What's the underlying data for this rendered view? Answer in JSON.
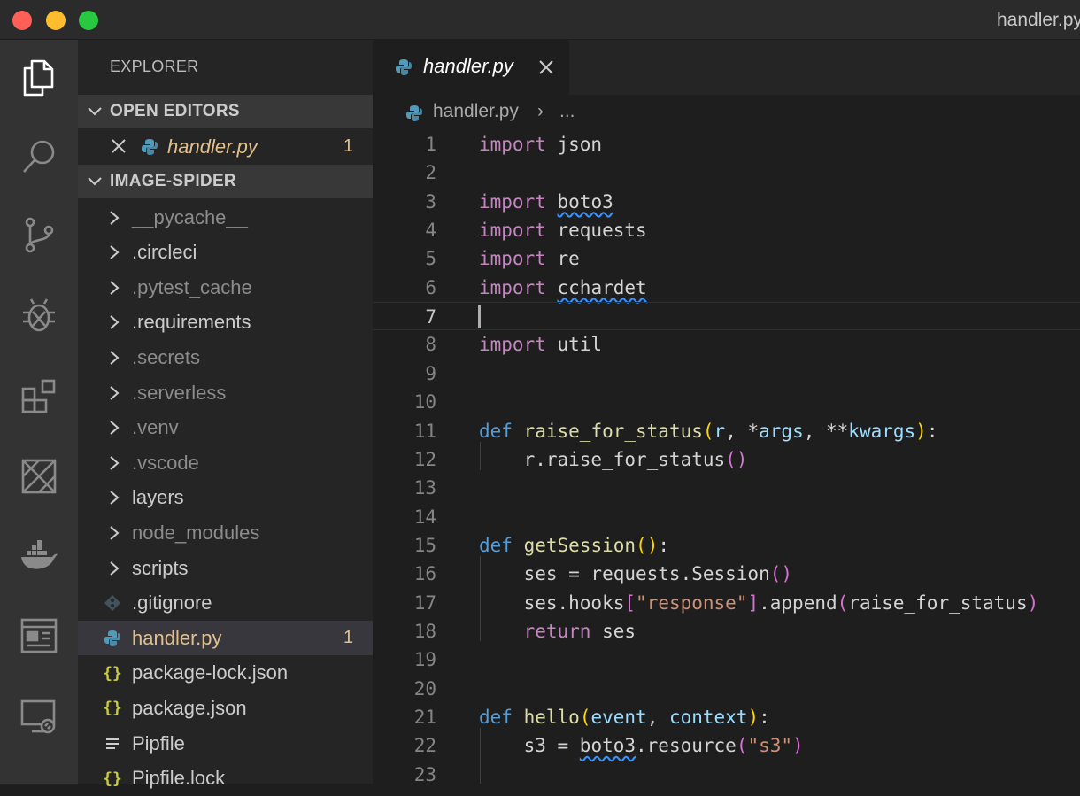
{
  "window": {
    "title": "handler.py"
  },
  "activity_bar": {
    "items": [
      "files-icon",
      "search-icon",
      "source-control-icon",
      "debug-icon",
      "extensions-icon",
      "aws-icon",
      "docker-icon",
      "panel-icon",
      "remote-explorer-icon"
    ]
  },
  "sidebar": {
    "title": "EXPLORER",
    "open_editors": {
      "label": "OPEN EDITORS",
      "files": [
        {
          "name": "handler.py",
          "badge": "1"
        }
      ]
    },
    "folder": {
      "label": "IMAGE-SPIDER",
      "items": [
        {
          "name": "__pycache__",
          "type": "folder",
          "dim": true
        },
        {
          "name": ".circleci",
          "type": "folder",
          "dim": false
        },
        {
          "name": ".pytest_cache",
          "type": "folder",
          "dim": true
        },
        {
          "name": ".requirements",
          "type": "folder",
          "dim": false
        },
        {
          "name": ".secrets",
          "type": "folder",
          "dim": true
        },
        {
          "name": ".serverless",
          "type": "folder",
          "dim": true
        },
        {
          "name": ".venv",
          "type": "folder",
          "dim": true
        },
        {
          "name": ".vscode",
          "type": "folder",
          "dim": true
        },
        {
          "name": "layers",
          "type": "folder",
          "dim": false
        },
        {
          "name": "node_modules",
          "type": "folder",
          "dim": true
        },
        {
          "name": "scripts",
          "type": "folder",
          "dim": false
        },
        {
          "name": ".gitignore",
          "type": "git",
          "dim": false
        },
        {
          "name": "handler.py",
          "type": "python",
          "dim": false,
          "badge": "1",
          "selected": true
        },
        {
          "name": "package-lock.json",
          "type": "json",
          "dim": false
        },
        {
          "name": "package.json",
          "type": "json",
          "dim": false
        },
        {
          "name": "Pipfile",
          "type": "text",
          "dim": false
        },
        {
          "name": "Pipfile.lock",
          "type": "json",
          "dim": false
        }
      ]
    }
  },
  "editor": {
    "tab": {
      "label": "handler.py"
    },
    "breadcrumb": {
      "file": "handler.py",
      "separator": "›",
      "more": "..."
    },
    "lines": [
      "import json",
      "",
      "import boto3",
      "import requests",
      "import re",
      "import cchardet",
      "",
      "import util",
      "",
      "",
      "def raise_for_status(r, *args, **kwargs):",
      "    r.raise_for_status()",
      "",
      "",
      "def getSession():",
      "    ses = requests.Session()",
      "    ses.hooks[\"response\"].append(raise_for_status)",
      "    return ses",
      "",
      "",
      "def hello(event, context):",
      "    s3 = boto3.resource(\"s3\")",
      ""
    ]
  },
  "colors": {
    "keyword": "#c586c0",
    "def": "#569cd6",
    "function": "#dcdcaa",
    "param": "#9cdcfe",
    "string": "#ce9178",
    "modified": "#e2c08d"
  }
}
